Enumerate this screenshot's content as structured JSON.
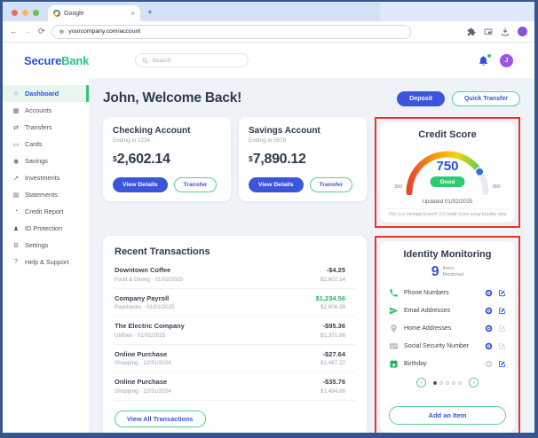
{
  "browser": {
    "tab_title": "Google",
    "url": "yourcompany.com/account"
  },
  "header": {
    "brand_secure": "Secure",
    "brand_bank": "Bank",
    "search_placeholder": "Search",
    "avatar_initial": "J"
  },
  "sidebar": {
    "items": [
      {
        "label": "Dashboard",
        "icon": "home-icon",
        "active": true
      },
      {
        "label": "Accounts",
        "icon": "accounts-icon"
      },
      {
        "label": "Transfers",
        "icon": "transfers-icon"
      },
      {
        "label": "Cards",
        "icon": "cards-icon"
      },
      {
        "label": "Savings",
        "icon": "savings-icon"
      },
      {
        "label": "Investments",
        "icon": "investments-icon"
      },
      {
        "label": "Statements",
        "icon": "statements-icon"
      },
      {
        "label": "Credit Report",
        "icon": "credit-report-icon"
      },
      {
        "label": "ID Protection",
        "icon": "id-protection-icon"
      },
      {
        "label": "Settings",
        "icon": "settings-icon"
      },
      {
        "label": "Help & Support",
        "icon": "help-icon"
      }
    ]
  },
  "main": {
    "welcome": "John, Welcome Back!",
    "deposit_label": "Deposit",
    "quick_transfer_label": "Quick Transfer"
  },
  "accounts": [
    {
      "title": "Checking Account",
      "subtitle": "Ending in 1234",
      "currency": "$",
      "balance": "2,602.14",
      "view_details_label": "View Details",
      "transfer_label": "Transfer"
    },
    {
      "title": "Savings Account",
      "subtitle": "Ending in 5678",
      "currency": "$",
      "balance": "7,890.12",
      "view_details_label": "View Details",
      "transfer_label": "Transfer"
    }
  ],
  "credit_score": {
    "title": "Credit Score",
    "score": "750",
    "rating": "Good",
    "range_min": "300",
    "range_max": "850",
    "updated": "Updated 01/02/2025",
    "disclaimer": "This is a VantageScore® 3.0 credit score using Equifax data",
    "score_color": "#2b50e0",
    "rating_color": "#2ecc71"
  },
  "transactions": {
    "title": "Recent Transactions",
    "view_all_label": "View All Transactions",
    "items": [
      {
        "name": "Downtown Coffee",
        "meta": "Food & Dining · 01/02/2025",
        "amount": "-$4.25",
        "balance": "$2,602.14"
      },
      {
        "name": "Company Payroll",
        "meta": "Paychecks · 01/01/2025",
        "amount": "$1,234.56",
        "balance": "$2,606.39"
      },
      {
        "name": "The Electric Company",
        "meta": "Utilities · 01/01/2025",
        "amount": "-$95.36",
        "balance": "$1,371.86"
      },
      {
        "name": "Online Purchase",
        "meta": "Shopping · 12/31/2024",
        "amount": "-$27.64",
        "balance": "$1,467.22"
      },
      {
        "name": "Online Purchase",
        "meta": "Shopping · 12/31/2024",
        "amount": "-$35.76",
        "balance": "$1,494.86"
      }
    ]
  },
  "identity": {
    "title": "Identity Monitoring",
    "count": "9",
    "count_line1": "Items",
    "count_line2": "Monitored",
    "add_item_label": "Add an Item",
    "items": [
      {
        "label": "Phone Numbers",
        "icon": "phone-icon"
      },
      {
        "label": "Email Addresses",
        "icon": "send-icon"
      },
      {
        "label": "Home Addresses",
        "icon": "map-pin-icon"
      },
      {
        "label": "Social Security Number",
        "icon": "id-card-icon"
      },
      {
        "label": "Birthday",
        "icon": "calendar-plus-icon"
      }
    ]
  },
  "colors": {
    "primary_blue": "#3b55dd",
    "accent_green": "#2ec27e",
    "annotation_red": "#e8352b"
  }
}
